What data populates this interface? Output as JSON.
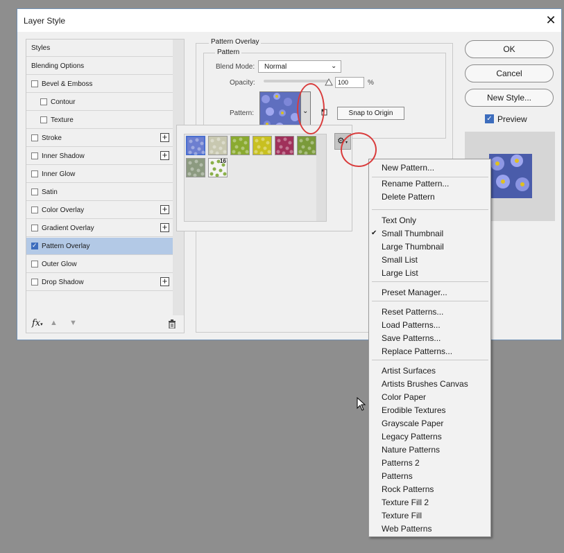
{
  "dialog": {
    "title": "Layer Style",
    "close_symbol": "✕",
    "buttons": {
      "ok": "OK",
      "cancel": "Cancel",
      "new_style": "New Style..."
    },
    "preview_label": "Preview"
  },
  "styles_list": {
    "items": [
      {
        "label": "Styles",
        "checkbox": false,
        "plus": false,
        "checked": false,
        "indent": 0
      },
      {
        "label": "Blending Options",
        "checkbox": false,
        "plus": false,
        "checked": false,
        "indent": 0
      },
      {
        "label": "Bevel & Emboss",
        "checkbox": true,
        "plus": false,
        "checked": false,
        "indent": 0
      },
      {
        "label": "Contour",
        "checkbox": true,
        "plus": false,
        "checked": false,
        "indent": 1
      },
      {
        "label": "Texture",
        "checkbox": true,
        "plus": false,
        "checked": false,
        "indent": 1
      },
      {
        "label": "Stroke",
        "checkbox": true,
        "plus": true,
        "checked": false,
        "indent": 0
      },
      {
        "label": "Inner Shadow",
        "checkbox": true,
        "plus": true,
        "checked": false,
        "indent": 0
      },
      {
        "label": "Inner Glow",
        "checkbox": true,
        "plus": false,
        "checked": false,
        "indent": 0
      },
      {
        "label": "Satin",
        "checkbox": true,
        "plus": false,
        "checked": false,
        "indent": 0
      },
      {
        "label": "Color Overlay",
        "checkbox": true,
        "plus": true,
        "checked": false,
        "indent": 0
      },
      {
        "label": "Gradient Overlay",
        "checkbox": true,
        "plus": true,
        "checked": false,
        "indent": 0
      },
      {
        "label": "Pattern Overlay",
        "checkbox": true,
        "plus": false,
        "checked": true,
        "indent": 0,
        "selected": true
      },
      {
        "label": "Outer Glow",
        "checkbox": true,
        "plus": false,
        "checked": false,
        "indent": 0
      },
      {
        "label": "Drop Shadow",
        "checkbox": true,
        "plus": true,
        "checked": false,
        "indent": 0
      }
    ],
    "fx_label": "fx"
  },
  "pattern_overlay": {
    "section_title": "Pattern Overlay",
    "group_title": "Pattern",
    "blend_mode_label": "Blend Mode:",
    "blend_mode_value": "Normal",
    "opacity_label": "Opacity:",
    "opacity_value": "100",
    "opacity_unit": "%",
    "pattern_label": "Pattern:",
    "snap_button": "Snap to Origin"
  },
  "picker": {
    "thumb_badge": "16",
    "thumb_colors": [
      "#6d7fd0",
      "#c8c8b0",
      "#8aaa30",
      "#c8c020",
      "#a0305a",
      "#7a9a3a",
      "#8c9a80",
      "#f4f4f4"
    ]
  },
  "menu": {
    "items": [
      "New Pattern...",
      "Rename Pattern...",
      "Delete Pattern",
      "Text Only",
      "Small Thumbnail",
      "Large Thumbnail",
      "Small List",
      "Large List",
      "Preset Manager...",
      "Reset Patterns...",
      "Load Patterns...",
      "Save Patterns...",
      "Replace Patterns...",
      "Artist Surfaces",
      "Artists Brushes Canvas",
      "Color Paper",
      "Erodible Textures",
      "Grayscale Paper",
      "Legacy Patterns",
      "Nature Patterns",
      "Patterns 2",
      "Patterns",
      "Rock Patterns",
      "Texture Fill 2",
      "Texture Fill",
      "Web Patterns"
    ],
    "checked_item": "Small Thumbnail",
    "check_symbol": "✔"
  },
  "colors": {
    "highlight_ring": "#d93b3b",
    "selected_row": "#b3c9e6",
    "accent": "#3d6dbd"
  }
}
